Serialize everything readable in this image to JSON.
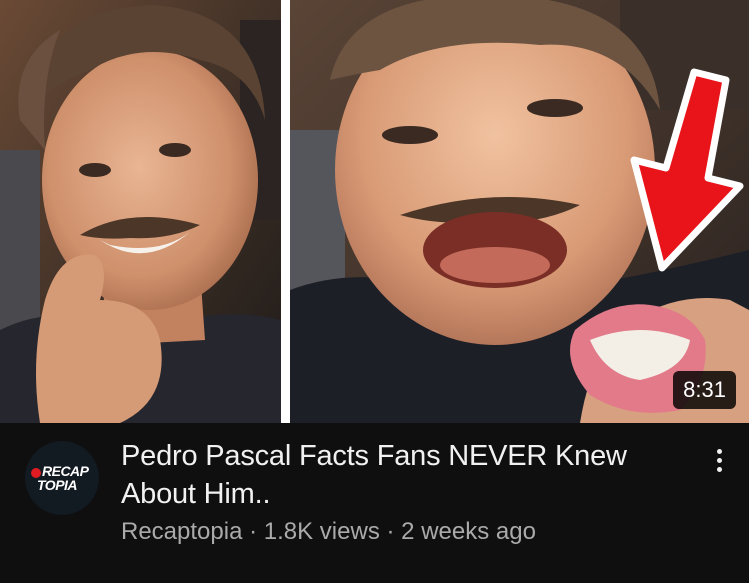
{
  "video": {
    "title": "Pedro Pascal Facts Fans NEVER Knew About Him..",
    "duration": "8:31",
    "channel_name": "Recaptopia",
    "views": "1.8K views",
    "age": "2 weeks ago",
    "separator": "·"
  },
  "avatar": {
    "logo_line1": "RECAP",
    "logo_line2": "TOPIA"
  },
  "icons": {
    "more": "more-vertical-icon",
    "arrow": "red-down-arrow-icon"
  },
  "colors": {
    "background": "#0f0f0f",
    "title": "#f1f1f1",
    "meta": "#aaaaaa",
    "arrow_red": "#e8141a",
    "avatar_red": "#e11b22"
  }
}
